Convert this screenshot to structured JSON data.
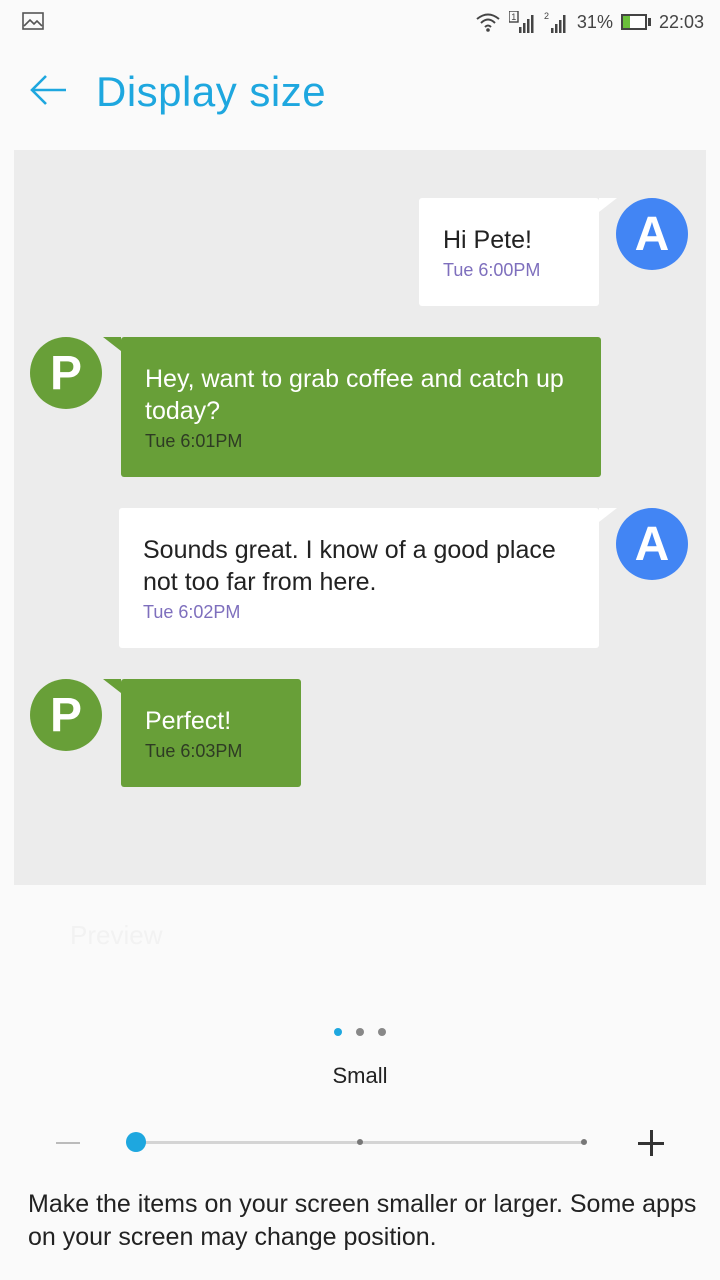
{
  "status_bar": {
    "sim1_badge": "1",
    "sim2_badge": "2",
    "battery_percent": "31%",
    "battery_level": 0.31,
    "time": "22:03"
  },
  "header": {
    "title": "Display size"
  },
  "preview": {
    "messages": [
      {
        "sender": "A",
        "direction": "outgoing",
        "text": "Hi Pete!",
        "time": "Tue 6:00PM"
      },
      {
        "sender": "P",
        "direction": "incoming",
        "text": "Hey, want to grab coffee and catch up today?",
        "time": "Tue 6:01PM"
      },
      {
        "sender": "A",
        "direction": "outgoing",
        "text": "Sounds great. I know of a good place not too far from here.",
        "time": "Tue 6:02PM"
      },
      {
        "sender": "P",
        "direction": "incoming",
        "text": "Perfect!",
        "time": "Tue 6:03PM"
      }
    ]
  },
  "ghost_label": "Preview",
  "pager": {
    "count": 3,
    "active": 0
  },
  "size": {
    "label": "Small",
    "steps": 3,
    "selected_index": 0
  },
  "description": "Make the items on your screen smaller or larger. Some apps on your screen may change position.",
  "colors": {
    "accent": "#1ea7df",
    "avatar_a": "#4285f4",
    "incoming_bubble": "#689f38",
    "outgoing_time": "#7e6fbd"
  }
}
